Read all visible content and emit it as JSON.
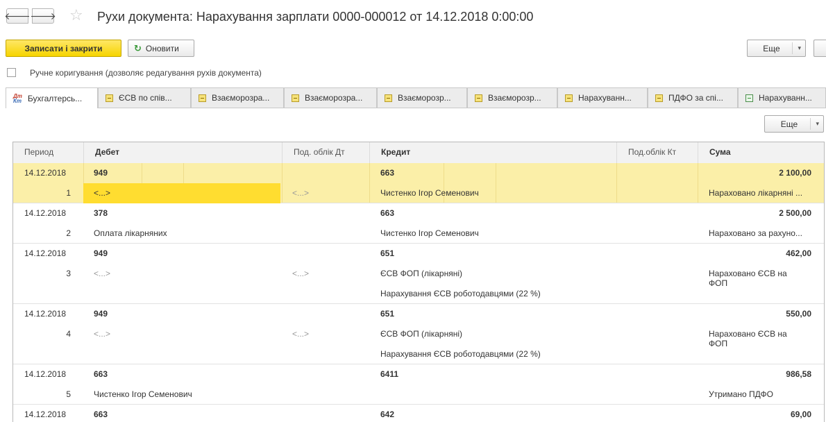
{
  "window": {
    "title": "Рухи документа: Нарахування зарплати 0000-000012 от 14.12.2018 0:00:00",
    "back_glyph": "🡐",
    "forward_glyph": "🡒",
    "star_glyph": "☆"
  },
  "toolbar": {
    "save_close_label": "Записати і закрити",
    "refresh_label": "Оновити",
    "refresh_glyph": "↻",
    "more_label": "Еще",
    "caret_glyph": "▾"
  },
  "manual_edit": {
    "label": "Ручне коригування (дозволяє редагування рухів документа)",
    "checked": false
  },
  "tabs": [
    {
      "label": "Бухгалтерсь...",
      "icon": "dt-kt-icon",
      "active": true
    },
    {
      "label": "ЄСВ по спів...",
      "icon": "register-icon"
    },
    {
      "label": "Взаєморозра...",
      "icon": "register-icon"
    },
    {
      "label": "Взаєморозра...",
      "icon": "register-icon"
    },
    {
      "label": "Взаєморозр...",
      "icon": "register-icon"
    },
    {
      "label": "Взаєморозр...",
      "icon": "register-icon"
    },
    {
      "label": "Нарахуванн...",
      "icon": "register-icon"
    },
    {
      "label": "ПДФО за спі...",
      "icon": "register-icon"
    },
    {
      "label": "Нарахуванн...",
      "icon": "register-green-icon"
    }
  ],
  "tab_panel": {
    "more_label": "Еще"
  },
  "grid": {
    "columns": {
      "period": "Период",
      "debit": "Дебет",
      "sub_debit": "Под. облік Дт",
      "credit": "Кредит",
      "sub_credit": "Под.облік Кт",
      "amount": "Сума"
    },
    "rows": [
      {
        "period": "14.12.2018",
        "num": "1",
        "debit": "949",
        "debit_sub": "<...>",
        "sub_debit": "<...>",
        "credit": "663",
        "credit_sub": "Чистенко Ігор Семенович",
        "credit_sub2": "",
        "amount": "2 100,00",
        "content": "Нараховано лікарняні ..."
      },
      {
        "period": "14.12.2018",
        "num": "2",
        "debit": "378",
        "debit_sub": "Оплата лікарняних",
        "sub_debit": "",
        "credit": "663",
        "credit_sub": "Чистенко Ігор Семенович",
        "credit_sub2": "",
        "amount": "2 500,00",
        "content": "Нараховано за рахуно..."
      },
      {
        "period": "14.12.2018",
        "num": "3",
        "debit": "949",
        "debit_sub": "<...>",
        "sub_debit": "<...>",
        "credit": "651",
        "credit_sub": "ЄСВ ФОП (лікарняні)",
        "credit_sub2": "Нарахування ЄСВ роботодавцями (22 %)",
        "amount": "462,00",
        "content": "Нараховано ЄСВ на ФОП"
      },
      {
        "period": "14.12.2018",
        "num": "4",
        "debit": "949",
        "debit_sub": "<...>",
        "sub_debit": "<...>",
        "credit": "651",
        "credit_sub": "ЄСВ ФОП (лікарняні)",
        "credit_sub2": "Нарахування ЄСВ роботодавцями (22 %)",
        "amount": "550,00",
        "content": "Нараховано ЄСВ на ФОП"
      },
      {
        "period": "14.12.2018",
        "num": "5",
        "debit": "663",
        "debit_sub": "Чистенко Ігор Семенович",
        "sub_debit": "",
        "credit": "6411",
        "credit_sub": "",
        "credit_sub2": "",
        "amount": "986,58",
        "content": "Утримано ПДФО"
      },
      {
        "period": "14.12.2018",
        "num": "",
        "debit": "663",
        "debit_sub": "",
        "sub_debit": "",
        "credit": "642",
        "credit_sub": "",
        "credit_sub2": "",
        "amount": "69,00",
        "content": ""
      }
    ]
  }
}
